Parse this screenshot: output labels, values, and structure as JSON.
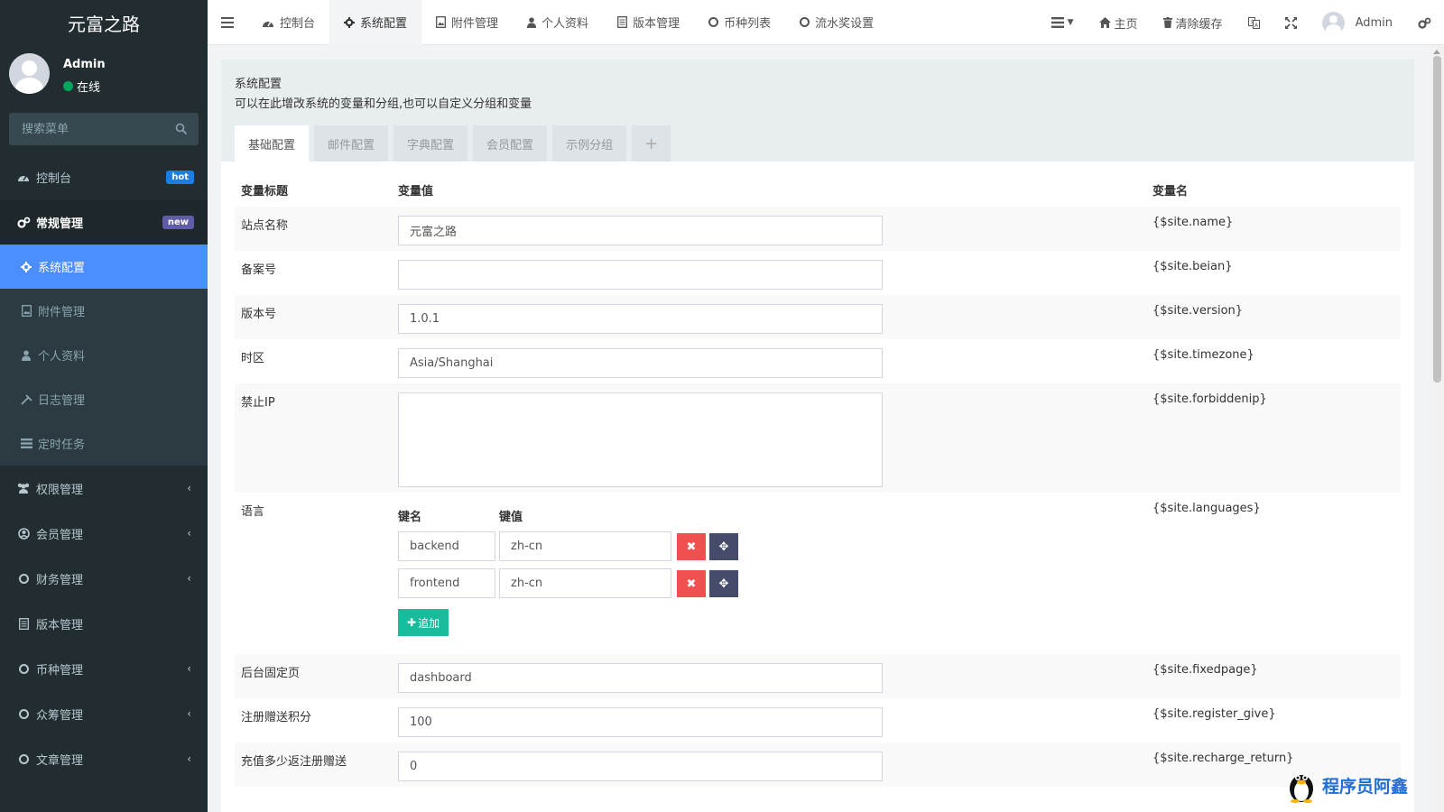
{
  "sidebar": {
    "brand": "元富之路",
    "user_name": "Admin",
    "user_status": "在线",
    "search_placeholder": "搜索菜单",
    "items": [
      {
        "label": "控制台",
        "badge": "hot"
      },
      {
        "label": "常规管理",
        "badge": "new"
      },
      {
        "label": "权限管理"
      },
      {
        "label": "会员管理"
      },
      {
        "label": "财务管理"
      },
      {
        "label": "版本管理"
      },
      {
        "label": "币种管理"
      },
      {
        "label": "众筹管理"
      },
      {
        "label": "文章管理"
      }
    ],
    "subitems": [
      {
        "label": "系统配置"
      },
      {
        "label": "附件管理"
      },
      {
        "label": "个人资料"
      },
      {
        "label": "日志管理"
      },
      {
        "label": "定时任务"
      }
    ]
  },
  "topbar": {
    "tabs": [
      {
        "label": "控制台"
      },
      {
        "label": "系统配置"
      },
      {
        "label": "附件管理"
      },
      {
        "label": "个人资料"
      },
      {
        "label": "版本管理"
      },
      {
        "label": "币种列表"
      },
      {
        "label": "流水奖设置"
      }
    ],
    "home": "主页",
    "clear_cache": "清除缓存",
    "user": "Admin"
  },
  "panel": {
    "title": "系统配置",
    "desc": "可以在此增改系统的变量和分组,也可以自定义分组和变量",
    "tabs": [
      {
        "label": "基础配置"
      },
      {
        "label": "邮件配置"
      },
      {
        "label": "字典配置"
      },
      {
        "label": "会员配置"
      },
      {
        "label": "示例分组"
      }
    ],
    "plus": "+"
  },
  "table": {
    "headers": {
      "title": "变量标题",
      "value": "变量值",
      "name": "变量名"
    },
    "rows": [
      {
        "title": "站点名称",
        "value": "元富之路",
        "name": "{$site.name}"
      },
      {
        "title": "备案号",
        "value": "",
        "name": "{$site.beian}"
      },
      {
        "title": "版本号",
        "value": "1.0.1",
        "name": "{$site.version}"
      },
      {
        "title": "时区",
        "value": "Asia/Shanghai",
        "name": "{$site.timezone}"
      },
      {
        "title": "禁止IP",
        "value": "",
        "name": "{$site.forbiddenip}"
      },
      {
        "title": "语言",
        "name": "{$site.languages}"
      },
      {
        "title": "后台固定页",
        "value": "dashboard",
        "name": "{$site.fixedpage}"
      },
      {
        "title": "注册赠送积分",
        "value": "100",
        "name": "{$site.register_give}"
      },
      {
        "title": "充值多少返注册赠送",
        "value": "0",
        "name": "{$site.recharge_return}"
      }
    ],
    "kv_headers": {
      "key": "键名",
      "value": "键值"
    },
    "kv": [
      {
        "key": "backend",
        "value": "zh-cn"
      },
      {
        "key": "frontend",
        "value": "zh-cn"
      }
    ],
    "add_label": "追加"
  },
  "watermark": "程序员阿鑫",
  "colors": {
    "sidebar_bg": "#222d32",
    "active_blue": "#4a8eff",
    "add_green": "#18bc9c",
    "delete_red": "#f05050",
    "move_dark": "#444c69"
  }
}
